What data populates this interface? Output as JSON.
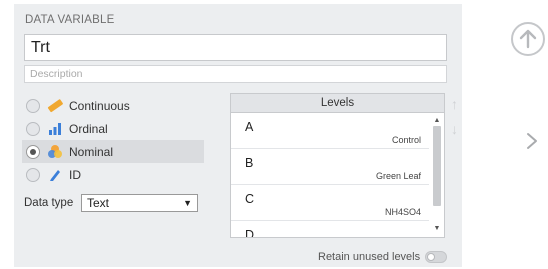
{
  "section_title": "DATA VARIABLE",
  "variable": {
    "name": "Trt",
    "description_placeholder": "Description"
  },
  "measure_types": [
    {
      "label": "Continuous",
      "icon": "ruler-icon",
      "selected": false
    },
    {
      "label": "Ordinal",
      "icon": "bar-chart-icon",
      "selected": false
    },
    {
      "label": "Nominal",
      "icon": "venn-circles-icon",
      "selected": true
    },
    {
      "label": "ID",
      "icon": "tag-icon",
      "selected": false
    }
  ],
  "data_type": {
    "label": "Data type",
    "value": "Text"
  },
  "levels": {
    "header": "Levels",
    "items": [
      {
        "value": "A",
        "label": "Control"
      },
      {
        "value": "B",
        "label": "Green Leaf"
      },
      {
        "value": "C",
        "label": "NH4SO4"
      },
      {
        "value": "D",
        "label": ""
      }
    ]
  },
  "retain_unused_levels": {
    "label": "Retain unused levels",
    "enabled": false
  },
  "colors": {
    "panel_bg": "#eceef0",
    "continuous_icon": "#f0a830",
    "ordinal_icon": "#3b7fd9",
    "nominal_icon_a": "#f3a53c",
    "nominal_icon_b": "#4a86d6",
    "id_icon": "#3b7fd9"
  }
}
